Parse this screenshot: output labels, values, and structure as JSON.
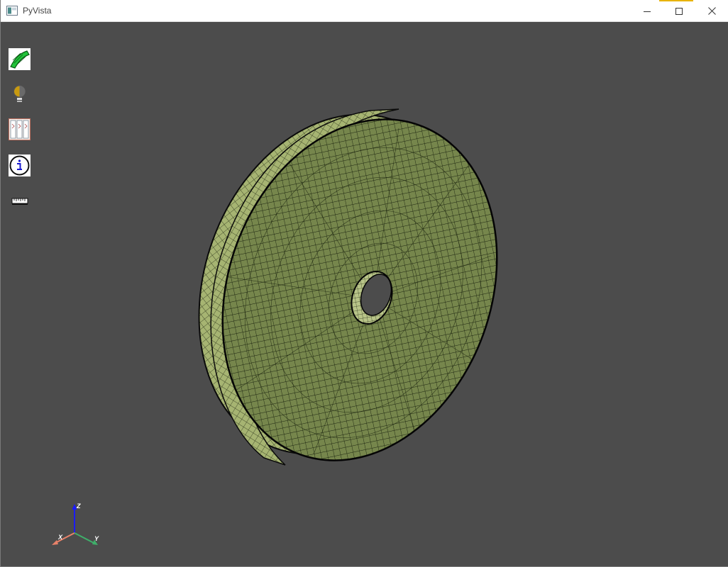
{
  "window": {
    "title": "PyVista",
    "controls": [
      "minimize",
      "maximize",
      "close"
    ]
  },
  "toolbar": {
    "tools": [
      {
        "icon": "surface-mesh-icon",
        "name": "mesh-display-tool"
      },
      {
        "icon": "lightbulb-icon",
        "name": "lighting-tool"
      },
      {
        "icon": "parallel-projection-icon",
        "name": "projection-tool"
      },
      {
        "icon": "info-icon",
        "name": "info-tool"
      },
      {
        "icon": "ruler-icon",
        "name": "measure-tool"
      }
    ]
  },
  "scene": {
    "object": "annular-disk-mesh",
    "mesh_color": "#7a8a50",
    "edge_color": "#111111",
    "background_color": "#4c4c4c"
  },
  "axes": {
    "x_label": "X",
    "y_label": "Y",
    "z_label": "Z",
    "x_color": "#e8826a",
    "y_color": "#3fae6a",
    "z_color": "#1a1aff"
  }
}
